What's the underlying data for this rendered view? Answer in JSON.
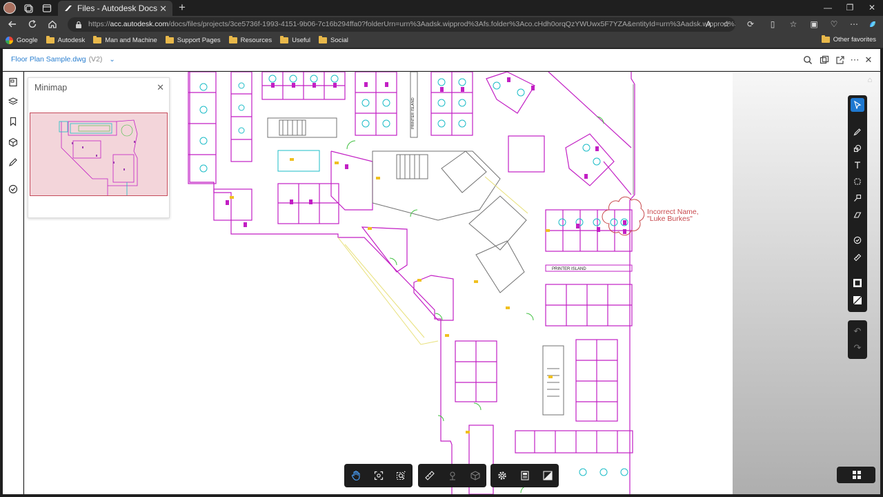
{
  "browser": {
    "tab_title": "Files - Autodesk Docs",
    "url_prefix": "https://",
    "url_host": "acc.autodesk.com",
    "url_path": "/docs/files/projects/3ce5736f-1993-4151-9b06-7c16b294ffa0?folderUrn=urn%3Aadsk.wipprod%3Afs.folder%3Aco.cHdh0orqQzYWUwx5F7YZA&entityId=urn%3Aadsk.wipprod%3Adm.lin...",
    "bookmarks": [
      "Google",
      "Autodesk",
      "Man and Machine",
      "Support Pages",
      "Resources",
      "Useful",
      "Social"
    ],
    "other_favorites": "Other favorites"
  },
  "header": {
    "file_name": "Floor Plan Sample.dwg",
    "version": "(V2)"
  },
  "minimap": {
    "title": "Minimap"
  },
  "drawing": {
    "printer_island_horizontal": "PRINTER ISLAND",
    "printer_island_vertical": "PRINTER ISLAND"
  },
  "markup": {
    "line1": "Incorrect Name,",
    "line2": "\"Luke Burkes\"",
    "color": "#c8494d"
  },
  "colors": {
    "accent": "#1f79d1",
    "wall_magenta": "#c21fc4",
    "furniture_cyan": "#1bbcc7",
    "door_green": "#3cbf3c",
    "label_yellow": "#f0c020",
    "minimap_view": "#f3d5da"
  }
}
